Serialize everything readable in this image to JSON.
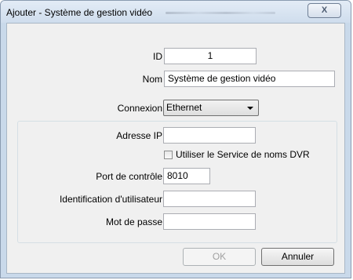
{
  "window": {
    "title": "Ajouter - Système de gestion vidéo",
    "close_glyph": "X"
  },
  "form": {
    "id_label": "ID",
    "id_value": "1",
    "name_label": "Nom",
    "name_value": "Système de gestion vidéo",
    "connection_label": "Connexion",
    "connection_value": "Ethernet",
    "ip_label": "Adresse IP",
    "ip_value": "",
    "dvr_checkbox_label": "Utiliser le Service de noms DVR",
    "dvr_checked": false,
    "port_label": "Port de contrôle",
    "port_value": "8010",
    "user_label": "Identification d'utilisateur",
    "user_value": "",
    "password_label": "Mot de passe",
    "password_value": ""
  },
  "buttons": {
    "ok_label": "OK",
    "cancel_label": "Annuler"
  },
  "icons": {
    "combo_arrow": "chevron-down-icon",
    "close": "close-icon"
  }
}
